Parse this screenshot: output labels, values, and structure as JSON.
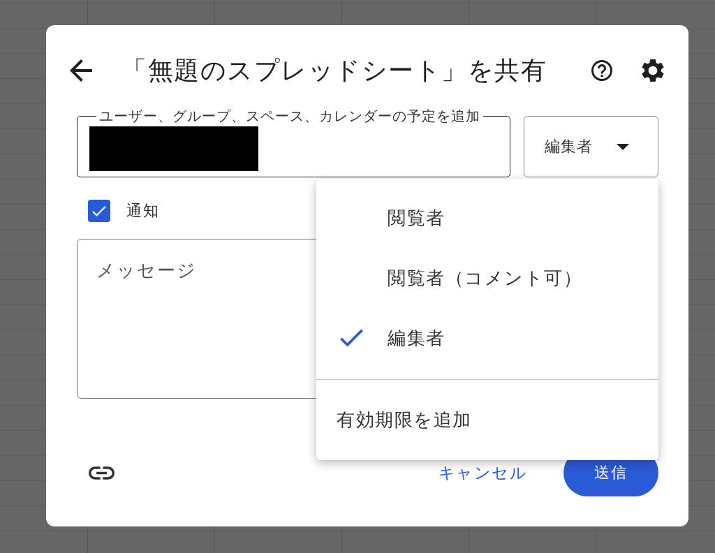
{
  "dialog": {
    "title": "「無題のスプレッドシート」を共有"
  },
  "add_people_field": {
    "label": "ユーザー、グループ、スペース、カレンダーの予定を追加",
    "redacted": true
  },
  "role_dropdown": {
    "value": "編集者",
    "expanded": true
  },
  "notify": {
    "label": "通知",
    "checked": true
  },
  "message": {
    "placeholder": "メッセージ"
  },
  "role_menu": {
    "items": [
      {
        "label": "閲覧者",
        "selected": false
      },
      {
        "label": "閲覧者（コメント可）",
        "selected": false
      },
      {
        "label": "編集者",
        "selected": true
      }
    ],
    "extra_item": "有効期限を追加"
  },
  "actions": {
    "cancel": "キャンセル",
    "send": "送信"
  }
}
